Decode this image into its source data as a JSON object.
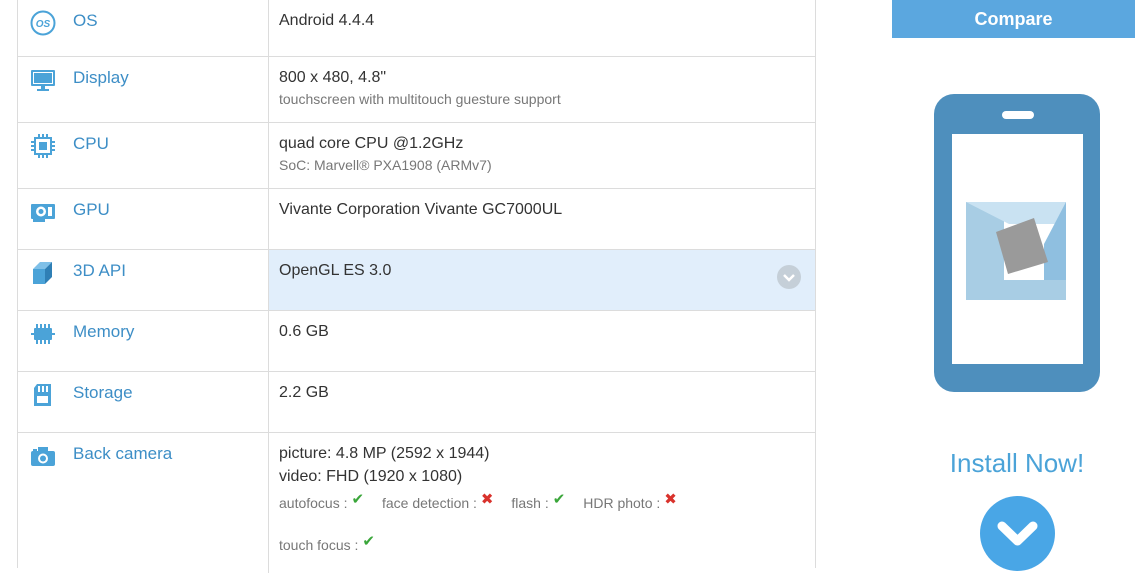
{
  "specs": [
    {
      "label": "OS",
      "icon": "os-icon",
      "value": "Android 4.4.4"
    },
    {
      "label": "Display",
      "icon": "monitor-icon",
      "value": "800 x 480, 4.8\"",
      "sub": "touchscreen with multitouch guesture support"
    },
    {
      "label": "CPU",
      "icon": "cpu-chip-icon",
      "value": "quad core CPU @1.2GHz",
      "sub": "SoC: Marvell® PXA1908 (ARMv7)"
    },
    {
      "label": "GPU",
      "icon": "gpu-card-icon",
      "value": "Vivante Corporation Vivante GC7000UL"
    },
    {
      "label": "3D API",
      "icon": "cube-icon",
      "value": "OpenGL ES 3.0"
    },
    {
      "label": "Memory",
      "icon": "memory-chip-icon",
      "value": "0.6 GB"
    },
    {
      "label": "Storage",
      "icon": "sd-card-icon",
      "value": "2.2 GB"
    },
    {
      "label": "Back camera",
      "icon": "camera-icon",
      "value": "picture: 4.8 MP (2592 x 1944)",
      "value2": "video: FHD (1920 x 1080)"
    }
  ],
  "camera_features": [
    {
      "label": "autofocus :",
      "supported": true,
      "mark": "✔"
    },
    {
      "label": "face detection :",
      "supported": false,
      "mark": "✖"
    },
    {
      "label": "flash :",
      "supported": true,
      "mark": "✔"
    },
    {
      "label": "HDR photo :",
      "supported": false,
      "mark": "✖"
    },
    {
      "label": "touch focus :",
      "supported": true,
      "mark": "✔"
    }
  ],
  "sidebar": {
    "compare_label": "Compare",
    "install_label": "Install Now!"
  },
  "colors": {
    "accent": "#3d8ec6",
    "button": "#5ba7df",
    "highlight_row": "#e1eefb",
    "check": "#3aa63a",
    "cross": "#d9322c"
  }
}
